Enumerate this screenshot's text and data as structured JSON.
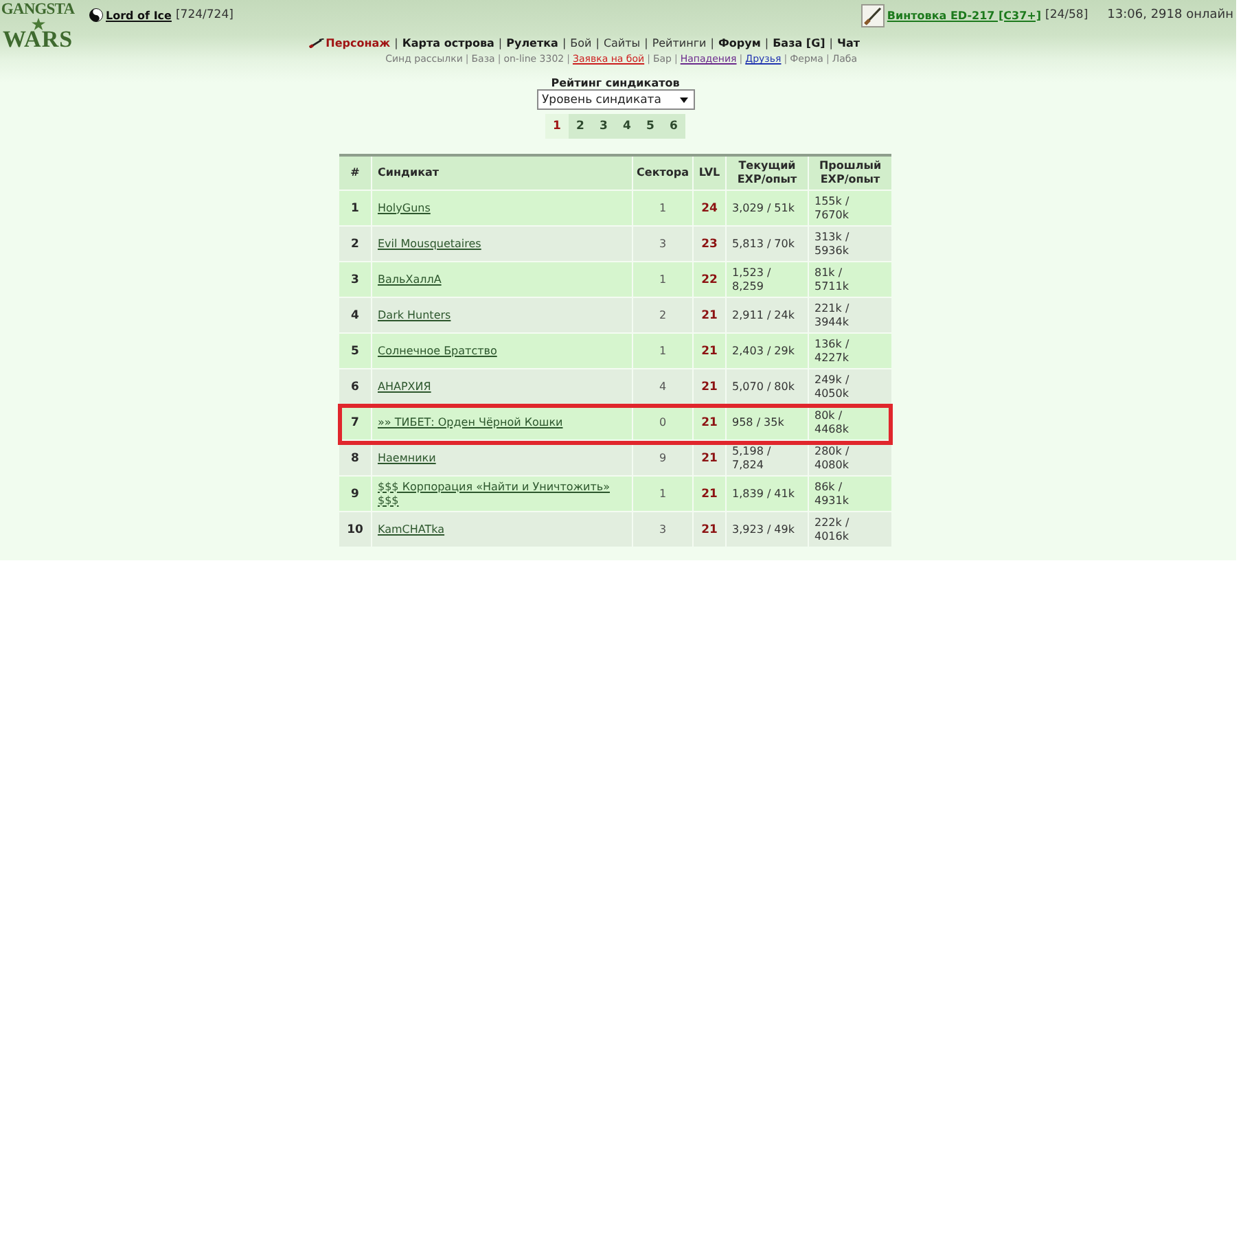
{
  "logo": {
    "top": "GANGSTA",
    "bottom": "WARS"
  },
  "user": {
    "name": "Lord of Ice",
    "health": "[724/724]"
  },
  "weapon": {
    "name": "Винтовка ED-217 [C37+]",
    "ammo": "[24/58]"
  },
  "status": "13:06, 2918 онлайн",
  "nav": {
    "separator": "|",
    "items": [
      {
        "label": "Персонаж",
        "kind": "main",
        "selected": true
      },
      {
        "label": "Карта острова",
        "kind": "main",
        "selected": false
      },
      {
        "label": "Рулетка",
        "kind": "main",
        "selected": false
      },
      {
        "label": "Бой",
        "kind": "minor",
        "selected": false
      },
      {
        "label": "Сайты",
        "kind": "minor",
        "selected": false
      },
      {
        "label": "Рейтинги",
        "kind": "minor",
        "selected": false
      },
      {
        "label": "Форум",
        "kind": "main",
        "selected": false
      },
      {
        "label": "База [G]",
        "kind": "main",
        "selected": false
      },
      {
        "label": "Чат",
        "kind": "main",
        "selected": false
      }
    ]
  },
  "subnav": {
    "separator": "|",
    "items": [
      {
        "label": "Синд рассылки",
        "kind": "muted"
      },
      {
        "label": "База",
        "kind": "muted"
      },
      {
        "label": "on-line 3302",
        "kind": "info"
      },
      {
        "label": "Заявка на бой",
        "kind": "alert"
      },
      {
        "label": "Бар",
        "kind": "muted"
      },
      {
        "label": "Нападения",
        "kind": "visited"
      },
      {
        "label": "Друзья",
        "kind": "link"
      },
      {
        "label": "Ферма",
        "kind": "muted"
      },
      {
        "label": "Лаба",
        "kind": "muted"
      }
    ]
  },
  "ranking": {
    "title": "Рейтинг синдикатов",
    "sort_select": {
      "value": "Уровень синдиката"
    },
    "pages": [
      {
        "label": "1",
        "selected": true
      },
      {
        "label": "2",
        "selected": false
      },
      {
        "label": "3",
        "selected": false
      },
      {
        "label": "4",
        "selected": false
      },
      {
        "label": "5",
        "selected": false
      },
      {
        "label": "6",
        "selected": false
      }
    ],
    "table": {
      "columns": [
        "#",
        "Синдикат",
        "Сектора",
        "LVL",
        "Текущий EXP/опыт",
        "Прошлый EXP/опыт"
      ],
      "rows": [
        {
          "rank": "1",
          "name": "HolyGuns",
          "sectors": "1",
          "level": "24",
          "current_exp": "3,029 / 51k",
          "past_exp": "155k / 7670k",
          "marked": false
        },
        {
          "rank": "2",
          "name": "Evil Mousquetaires",
          "sectors": "3",
          "level": "23",
          "current_exp": "5,813 / 70k",
          "past_exp": "313k / 5936k",
          "marked": false
        },
        {
          "rank": "3",
          "name": "ВальХаллА",
          "sectors": "1",
          "level": "22",
          "current_exp": "1,523 / 8,259",
          "past_exp": "81k / 5711k",
          "marked": false
        },
        {
          "rank": "4",
          "name": "Dark Hunters",
          "sectors": "2",
          "level": "21",
          "current_exp": "2,911 / 24k",
          "past_exp": "221k / 3944k",
          "marked": false
        },
        {
          "rank": "5",
          "name": "Солнечное Братство",
          "sectors": "1",
          "level": "21",
          "current_exp": "2,403 / 29k",
          "past_exp": "136k / 4227k",
          "marked": false
        },
        {
          "rank": "6",
          "name": "АНАРХИЯ",
          "sectors": "4",
          "level": "21",
          "current_exp": "5,070 / 80k",
          "past_exp": "249k / 4050k",
          "marked": false
        },
        {
          "rank": "7",
          "name": "»» ТИБЕТ: Орден Чёрной Кошки",
          "sectors": "0",
          "level": "21",
          "current_exp": "958 / 35k",
          "past_exp": "80k / 4468k",
          "marked": true
        },
        {
          "rank": "8",
          "name": "Наемники",
          "sectors": "9",
          "level": "21",
          "current_exp": "5,198 / 7,824",
          "past_exp": "280k / 4080k",
          "marked": false
        },
        {
          "rank": "9",
          "name": "$$$ Корпорация «Найти и Уничтожить» $$$",
          "sectors": "1",
          "level": "21",
          "current_exp": "1,839 / 41k",
          "past_exp": "86k / 4931k",
          "marked": false
        },
        {
          "rank": "10",
          "name": "KamCHATka",
          "sectors": "3",
          "level": "21",
          "current_exp": "3,923 / 49k",
          "past_exp": "222k / 4016k",
          "marked": false
        }
      ]
    }
  }
}
